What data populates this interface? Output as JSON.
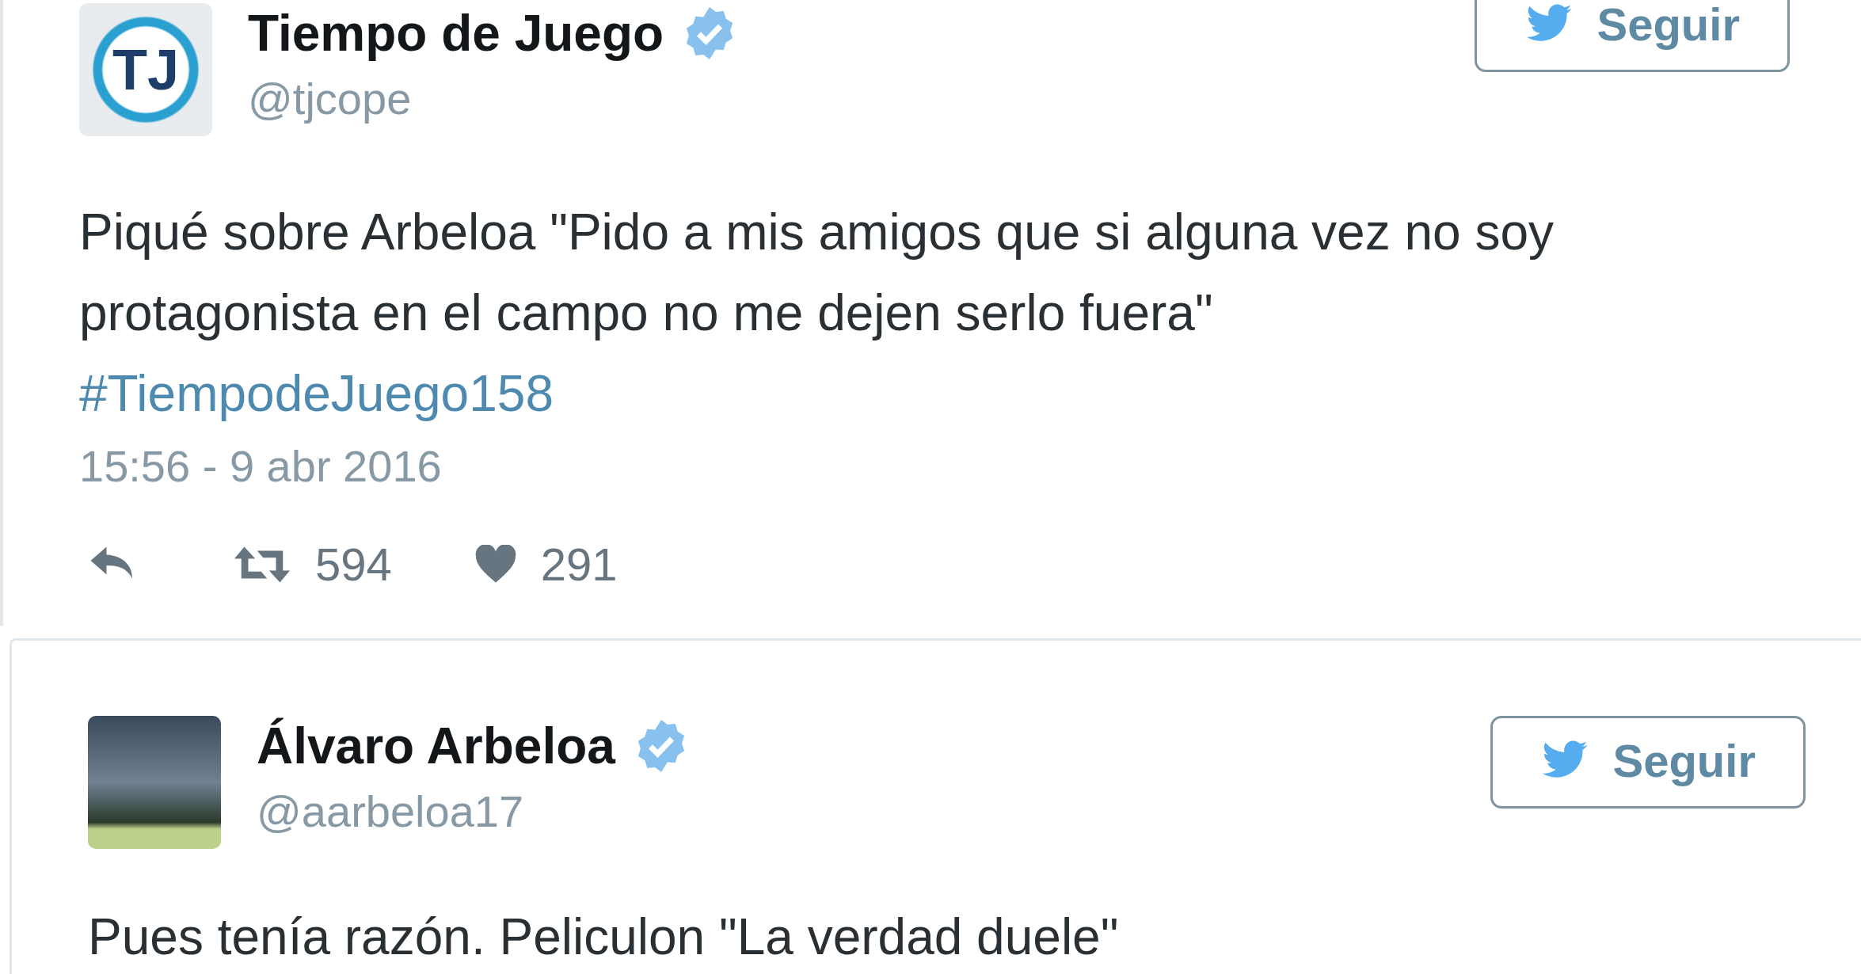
{
  "tweets": [
    {
      "name": "Tiempo de Juego",
      "handle": "@tjcope",
      "verified": true,
      "avatar": {
        "kind": "logo",
        "text": "TJ"
      },
      "follow": "Seguir",
      "text": "Piqué sobre Arbeloa \"Pido a mis amigos que si alguna vez no soy protagonista en el campo no me dejen serlo fuera\"",
      "hashtag": "#TiempodeJuego158",
      "time": "15:56 - 9 abr 2016",
      "retweets": "594",
      "likes": "291"
    },
    {
      "name": "Álvaro Arbeloa",
      "handle": "@aarbeloa17",
      "verified": true,
      "avatar": {
        "kind": "photo"
      },
      "follow": "Seguir",
      "text": "Pues tenía razón. Peliculon \"La verdad duele\""
    }
  ]
}
